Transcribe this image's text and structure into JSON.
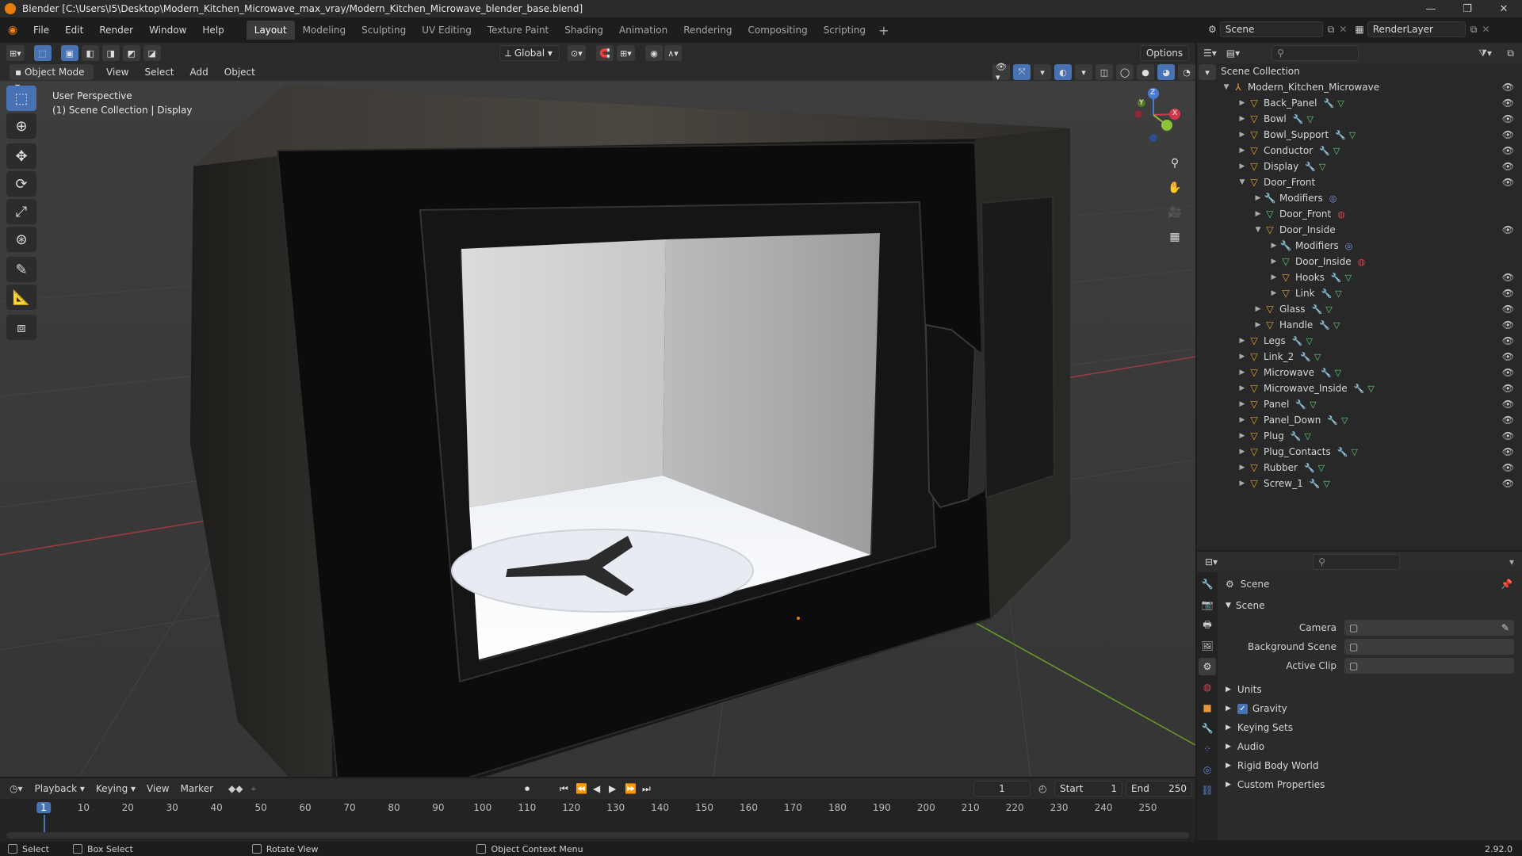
{
  "window": {
    "title": "Blender [C:\\Users\\I5\\Desktop\\Modern_Kitchen_Microwave_max_vray/Modern_Kitchen_Microwave_blender_base.blend]"
  },
  "menu": [
    "File",
    "Edit",
    "Render",
    "Window",
    "Help"
  ],
  "workspaces": [
    "Layout",
    "Modeling",
    "Sculpting",
    "UV Editing",
    "Texture Paint",
    "Shading",
    "Animation",
    "Rendering",
    "Compositing",
    "Scripting"
  ],
  "active_workspace": "Layout",
  "scene_selector": "Scene",
  "render_layer": "RenderLayer",
  "viewport": {
    "orientation": "Global",
    "options_label": "Options",
    "mode": "Object Mode",
    "header_menus": [
      "View",
      "Select",
      "Add",
      "Object"
    ],
    "overlay_line1": "User Perspective",
    "overlay_line2": "(1) Scene Collection | Display",
    "gizmo": {
      "z": "Z",
      "y": "Y",
      "x": "X"
    }
  },
  "outliner": {
    "root": "Scene Collection",
    "items": [
      {
        "label": "Modern_Kitchen_Microwave",
        "depth": 1,
        "arrow": "▼",
        "icon": "empty",
        "mods": false,
        "eye": true
      },
      {
        "label": "Back_Panel",
        "depth": 2,
        "arrow": "▶",
        "icon": "mesh",
        "mods": true,
        "eye": true
      },
      {
        "label": "Bowl",
        "depth": 2,
        "arrow": "▶",
        "icon": "mesh",
        "mods": true,
        "eye": true
      },
      {
        "label": "Bowl_Support",
        "depth": 2,
        "arrow": "▶",
        "icon": "mesh",
        "mods": true,
        "eye": true
      },
      {
        "label": "Conductor",
        "depth": 2,
        "arrow": "▶",
        "icon": "mesh",
        "mods": true,
        "eye": true
      },
      {
        "label": "Display",
        "depth": 2,
        "arrow": "▶",
        "icon": "mesh",
        "mods": true,
        "eye": true
      },
      {
        "label": "Door_Front",
        "depth": 2,
        "arrow": "▼",
        "icon": "mesh",
        "mods": false,
        "eye": true
      },
      {
        "label": "Modifiers",
        "depth": 3,
        "arrow": "▶",
        "icon": "wrench",
        "mods": false,
        "eye": false
      },
      {
        "label": "Door_Front",
        "depth": 3,
        "arrow": "▶",
        "icon": "meshdata",
        "mods": false,
        "eye": false
      },
      {
        "label": "Door_Inside",
        "depth": 3,
        "arrow": "▼",
        "icon": "mesh",
        "mods": false,
        "eye": true
      },
      {
        "label": "Modifiers",
        "depth": 4,
        "arrow": "▶",
        "icon": "wrench",
        "mods": false,
        "eye": false
      },
      {
        "label": "Door_Inside",
        "depth": 4,
        "arrow": "▶",
        "icon": "meshdata",
        "mods": false,
        "eye": false
      },
      {
        "label": "Hooks",
        "depth": 4,
        "arrow": "▶",
        "icon": "mesh",
        "mods": true,
        "eye": true
      },
      {
        "label": "Link",
        "depth": 4,
        "arrow": "▶",
        "icon": "mesh",
        "mods": true,
        "eye": true
      },
      {
        "label": "Glass",
        "depth": 3,
        "arrow": "▶",
        "icon": "mesh",
        "mods": true,
        "eye": true
      },
      {
        "label": "Handle",
        "depth": 3,
        "arrow": "▶",
        "icon": "mesh",
        "mods": true,
        "eye": true
      },
      {
        "label": "Legs",
        "depth": 2,
        "arrow": "▶",
        "icon": "mesh",
        "mods": true,
        "eye": true
      },
      {
        "label": "Link_2",
        "depth": 2,
        "arrow": "▶",
        "icon": "mesh",
        "mods": true,
        "eye": true
      },
      {
        "label": "Microwave",
        "depth": 2,
        "arrow": "▶",
        "icon": "mesh",
        "mods": true,
        "eye": true
      },
      {
        "label": "Microwave_Inside",
        "depth": 2,
        "arrow": "▶",
        "icon": "mesh",
        "mods": true,
        "eye": true
      },
      {
        "label": "Panel",
        "depth": 2,
        "arrow": "▶",
        "icon": "mesh",
        "mods": true,
        "eye": true
      },
      {
        "label": "Panel_Down",
        "depth": 2,
        "arrow": "▶",
        "icon": "mesh",
        "mods": true,
        "eye": true
      },
      {
        "label": "Plug",
        "depth": 2,
        "arrow": "▶",
        "icon": "mesh",
        "mods": true,
        "eye": true
      },
      {
        "label": "Plug_Contacts",
        "depth": 2,
        "arrow": "▶",
        "icon": "mesh",
        "mods": true,
        "eye": true
      },
      {
        "label": "Rubber",
        "depth": 2,
        "arrow": "▶",
        "icon": "mesh",
        "mods": true,
        "eye": true
      },
      {
        "label": "Screw_1",
        "depth": 2,
        "arrow": "▶",
        "icon": "mesh",
        "mods": true,
        "eye": true
      }
    ]
  },
  "properties": {
    "context": "Scene",
    "panel_title": "Scene",
    "fields": [
      {
        "label": "Camera"
      },
      {
        "label": "Background Scene"
      },
      {
        "label": "Active Clip"
      }
    ],
    "sections": [
      {
        "label": "Units",
        "checkbox": false
      },
      {
        "label": "Gravity",
        "checkbox": true
      },
      {
        "label": "Keying Sets",
        "checkbox": false
      },
      {
        "label": "Audio",
        "checkbox": false
      },
      {
        "label": "Rigid Body World",
        "checkbox": false
      },
      {
        "label": "Custom Properties",
        "checkbox": false
      }
    ]
  },
  "timeline": {
    "menus": [
      "Playback",
      "Keying",
      "View",
      "Marker"
    ],
    "current_frame": "1",
    "start_label": "Start",
    "start": "1",
    "end_label": "End",
    "end": "250",
    "ticks": [
      "1",
      "10",
      "20",
      "30",
      "40",
      "50",
      "60",
      "70",
      "80",
      "90",
      "100",
      "110",
      "120",
      "130",
      "140",
      "150",
      "160",
      "170",
      "180",
      "190",
      "200",
      "210",
      "220",
      "230",
      "240",
      "250"
    ]
  },
  "statusbar": {
    "items": [
      "Select",
      "Box Select",
      "Rotate View",
      "Object Context Menu"
    ],
    "version": "2.92.0"
  },
  "colors": {
    "accent": "#4772b3",
    "orange": "#e87d0d",
    "object": "#e2a43a",
    "mesh_data": "#5fd07a"
  }
}
